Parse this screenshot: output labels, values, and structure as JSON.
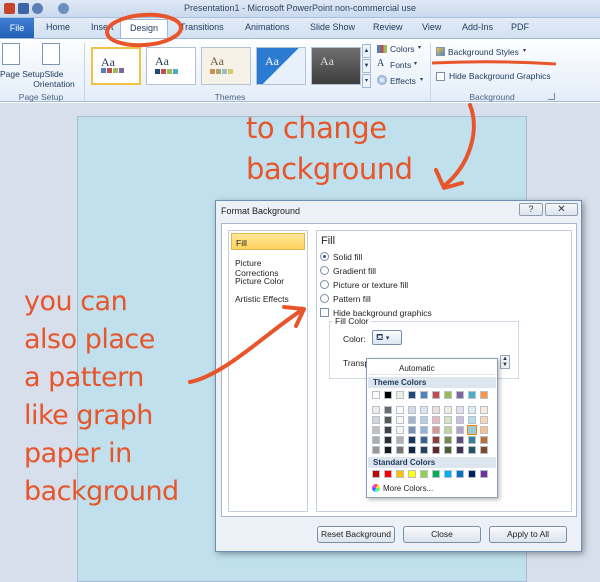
{
  "window": {
    "title": "Presentation1 - Microsoft PowerPoint non-commercial use"
  },
  "tabs": [
    "File",
    "Home",
    "Insert",
    "Design",
    "Transitions",
    "Animations",
    "Slide Show",
    "Review",
    "View",
    "Add-Ins",
    "PDF"
  ],
  "ribbon": {
    "page_setup": {
      "page_setup_label": "Page Setup",
      "orientation_label": "Slide Orientation",
      "group_label": "Page Setup"
    },
    "themes": {
      "thumb_text": "Aa",
      "group_label": "Themes"
    },
    "theme_options": {
      "colors": "Colors",
      "fonts": "Fonts",
      "effects": "Effects"
    },
    "background": {
      "styles": "Background Styles",
      "hide_graphics": "Hide Background Graphics",
      "group_label": "Background"
    }
  },
  "dialog": {
    "title": "Format Background",
    "help": "?",
    "close": "✕",
    "nav": [
      "Fill",
      "Picture Corrections",
      "Picture Color",
      "Artistic Effects"
    ],
    "fill": {
      "heading": "Fill",
      "options": [
        "Solid fill",
        "Gradient fill",
        "Picture or texture fill",
        "Pattern fill"
      ],
      "selected_option": "Solid fill",
      "hide_graphics": "Hide background graphics",
      "fill_color_label": "Fill Color",
      "color_label": "Color:",
      "transparency_label": "Transpa"
    },
    "buttons": {
      "reset": "Reset Background",
      "close": "Close",
      "apply_all": "Apply to All"
    }
  },
  "picker": {
    "automatic": "Automatic",
    "theme_colors_label": "Theme Colors",
    "standard_colors_label": "Standard Colors",
    "more_colors": "More Colors...",
    "theme_base": [
      "#ffffff",
      "#000000",
      "#eeece1",
      "#1f497d",
      "#4f81bd",
      "#c0504d",
      "#9bbb59",
      "#8064a2",
      "#4bacc6",
      "#f79646"
    ],
    "standard": [
      "#c00000",
      "#ff0000",
      "#ffc000",
      "#ffff00",
      "#92d050",
      "#00b050",
      "#00b0f0",
      "#0070c0",
      "#002060",
      "#7030a0"
    ]
  },
  "annotations": {
    "top": [
      "to change",
      "background"
    ],
    "left": [
      "you can",
      "also place",
      "a pattern",
      "like graph",
      "paper in",
      "background"
    ]
  },
  "colors": {
    "annotation": "#e8552b",
    "slide": "#bfe0ec",
    "selected_nav": "#ffd25c"
  }
}
